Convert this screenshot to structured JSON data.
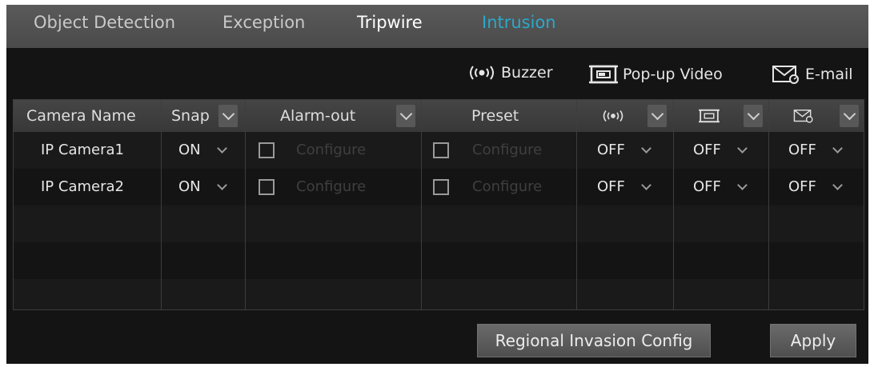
{
  "tabs": [
    {
      "label": "Object Detection"
    },
    {
      "label": "Exception"
    },
    {
      "label": "Tripwire"
    },
    {
      "label": "Intrusion"
    }
  ],
  "toolbar": {
    "buzzer_label": "Buzzer",
    "popup_label": "Pop-up Video",
    "email_label": "E-mail"
  },
  "table": {
    "headers": {
      "camera_name": "Camera Name",
      "snap": "Snap",
      "alarm_out": "Alarm-out",
      "preset": "Preset"
    },
    "rows": [
      {
        "camera": "IP Camera1",
        "snap": "ON",
        "alarm_out": "Configure",
        "preset": "Configure",
        "buzzer": "OFF",
        "popup": "OFF",
        "email": "OFF"
      },
      {
        "camera": "IP Camera2",
        "snap": "ON",
        "alarm_out": "Configure",
        "preset": "Configure",
        "buzzer": "OFF",
        "popup": "OFF",
        "email": "OFF"
      }
    ]
  },
  "buttons": {
    "regional": "Regional Invasion Config",
    "apply": "Apply"
  },
  "icons": {
    "buzzer": "buzzer-icon",
    "popup": "popup-video-icon",
    "email": "email-icon"
  },
  "colors": {
    "active_tab": "#2aa9c9",
    "background": "#141414"
  }
}
